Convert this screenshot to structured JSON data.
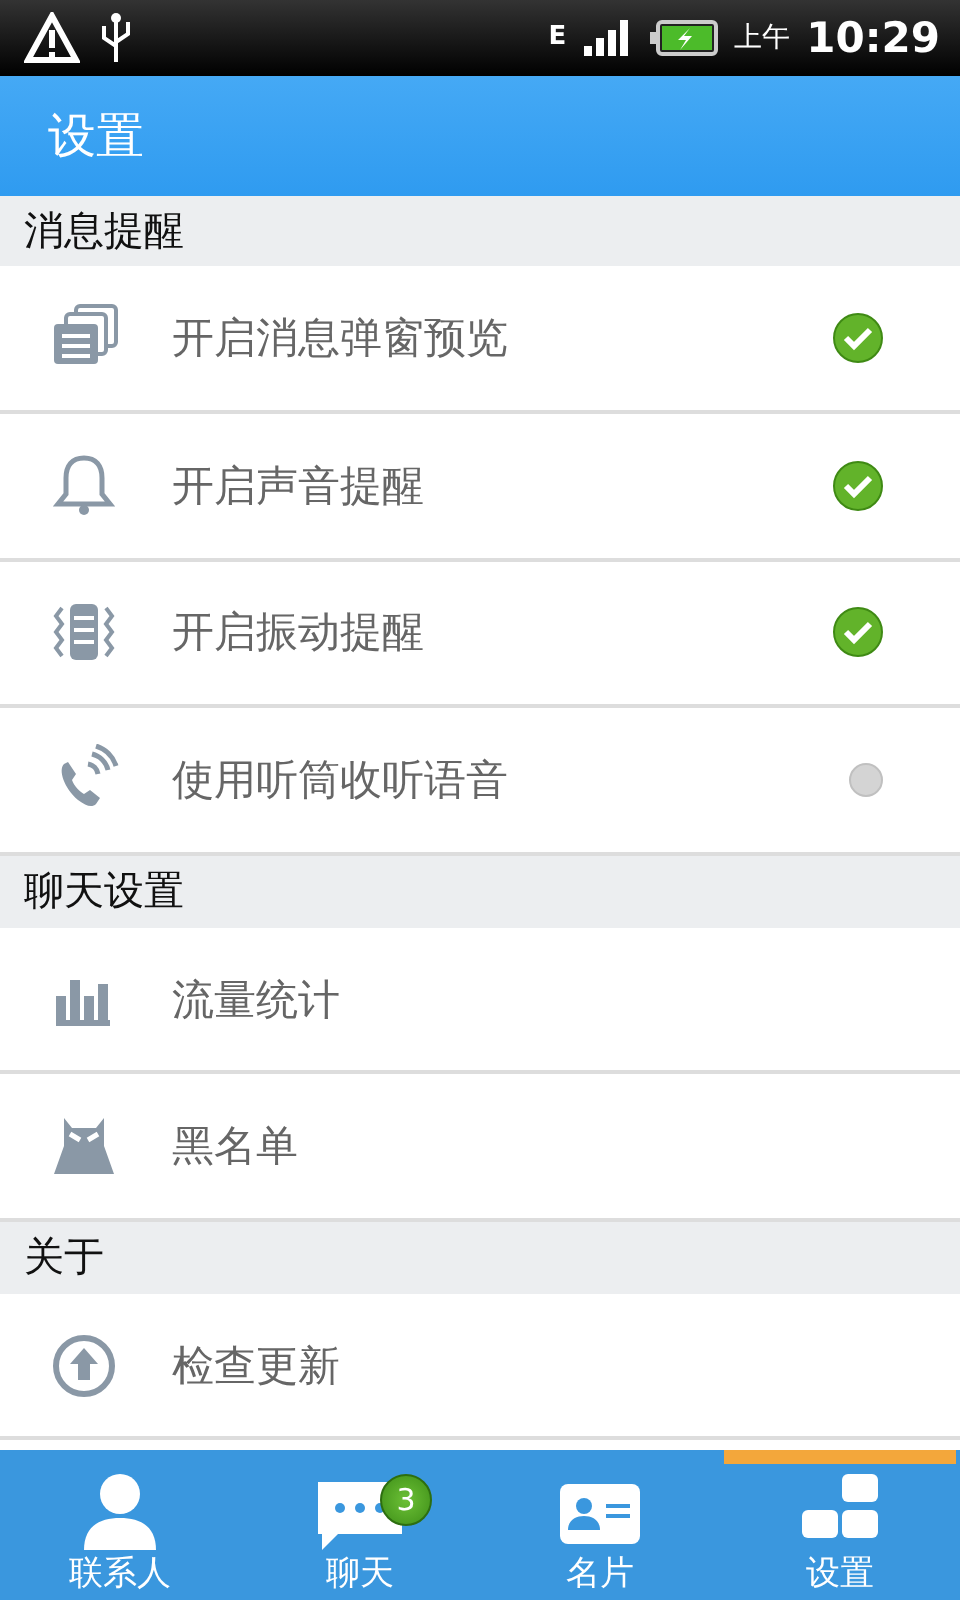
{
  "status_bar": {
    "network": "E",
    "ampm": "上午",
    "time": "10:29"
  },
  "header": {
    "title": "设置"
  },
  "sections": [
    {
      "title": "消息提醒",
      "items": [
        {
          "label": "开启消息弹窗预览",
          "checked": true
        },
        {
          "label": "开启声音提醒",
          "checked": true
        },
        {
          "label": "开启振动提醒",
          "checked": true
        },
        {
          "label": "使用听筒收听语音",
          "checked": false
        }
      ]
    },
    {
      "title": "聊天设置",
      "items": [
        {
          "label": "流量统计"
        },
        {
          "label": "黑名单"
        }
      ]
    },
    {
      "title": "关于",
      "items": [
        {
          "label": "检查更新"
        }
      ]
    }
  ],
  "tabs": [
    {
      "label": "联系人",
      "selected": false
    },
    {
      "label": "聊天",
      "selected": false,
      "badge": "3"
    },
    {
      "label": "名片",
      "selected": false
    },
    {
      "label": "设置",
      "selected": true
    }
  ]
}
